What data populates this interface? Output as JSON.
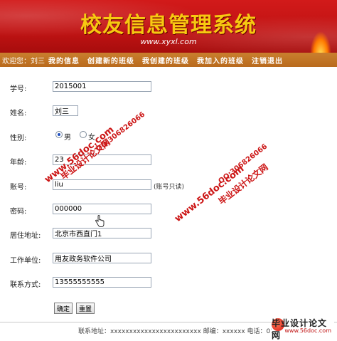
{
  "header": {
    "title": "校友信息管理系统",
    "url": "www.xyxl.com"
  },
  "nav": {
    "welcome": "欢迎您：",
    "user": "刘三",
    "items": [
      "我的信息",
      "创建新的班级",
      "我创建的班级",
      "我加入的班级",
      "注销退出"
    ]
  },
  "form": {
    "student_id": {
      "label": "学号:",
      "value": "2015001"
    },
    "name": {
      "label": "姓名:",
      "value": "刘三"
    },
    "gender": {
      "label": "性别:",
      "male": "男",
      "female": "女",
      "selected": "男"
    },
    "age": {
      "label": "年龄:",
      "value": "23"
    },
    "account": {
      "label": "账号:",
      "value": "liu",
      "note": "(账号只读)"
    },
    "password": {
      "label": "密码:",
      "value": "000000"
    },
    "address": {
      "label": "居住地址:",
      "value": "北京市西直门1"
    },
    "workplace": {
      "label": "工作单位:",
      "value": "用友政务软件公司"
    },
    "contact": {
      "label": "联系方式:",
      "value": "13555555555"
    },
    "confirm_label": "确定",
    "reset_label": "重置"
  },
  "watermarks": {
    "url": "www.56doc.com",
    "qq": "QQ:306826066",
    "cn": "毕业设计论文网"
  },
  "footer": {
    "text": "联系地址：xxxxxxxxxxxxxxxxxxxxxxxx  邮编：xxxxxx 电话：010"
  },
  "logo": {
    "title": "毕业设计论文网",
    "url": "www.56doc.com"
  },
  "colors": {
    "banner_red": "#c01313",
    "title_gold": "#f7c911",
    "nav_orange": "#c97f2e",
    "watermark_red": "#cc1515"
  }
}
